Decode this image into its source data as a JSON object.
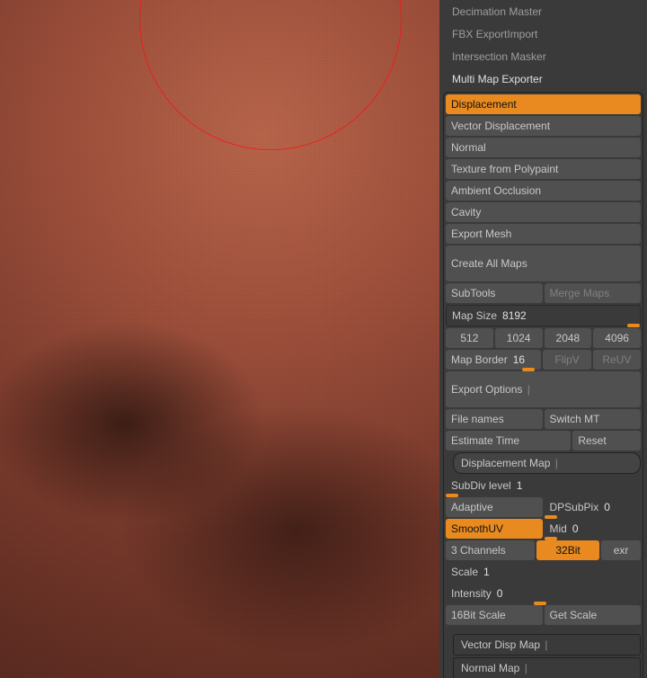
{
  "plugins": {
    "items": [
      "Decimation Master",
      "FBX ExportImport",
      "Intersection Masker",
      "Multi Map Exporter"
    ]
  },
  "mme": {
    "maps": {
      "displacement": "Displacement",
      "vectorDisplacement": "Vector Displacement",
      "normal": "Normal",
      "textureFromPolypaint": "Texture from Polypaint",
      "ambientOcclusion": "Ambient Occlusion",
      "cavity": "Cavity",
      "exportMesh": "Export Mesh"
    },
    "createAllMaps": "Create All Maps",
    "subTools": "SubTools",
    "mergeMaps": "Merge Maps",
    "mapSize": {
      "label": "Map Size",
      "value": "8192"
    },
    "sizes": {
      "s512": "512",
      "s1024": "1024",
      "s2048": "2048",
      "s4096": "4096"
    },
    "mapBorder": {
      "label": "Map Border",
      "value": "16"
    },
    "flipV": "FlipV",
    "reUV": "ReUV",
    "exportOptions": "Export Options",
    "fileNames": "File names",
    "switchMT": "Switch MT",
    "estimateTime": "Estimate Time",
    "reset": "Reset",
    "displacementMap": "Displacement Map",
    "subDivLevel": {
      "label": "SubDiv level",
      "value": "1"
    },
    "adaptive": "Adaptive",
    "dpSubPix": {
      "label": "DPSubPix",
      "value": "0"
    },
    "smoothUV": "SmoothUV",
    "mid": {
      "label": "Mid",
      "value": "0"
    },
    "threeChannels": "3 Channels",
    "bit32": "32Bit",
    "exr": "exr",
    "scale": {
      "label": "Scale",
      "value": "1"
    },
    "intensity": {
      "label": "Intensity",
      "value": "0"
    },
    "sixteenBitScale": "16Bit Scale",
    "getScale": "Get Scale",
    "vectorDispMap": "Vector Disp Map",
    "normalMap": "Normal Map"
  }
}
